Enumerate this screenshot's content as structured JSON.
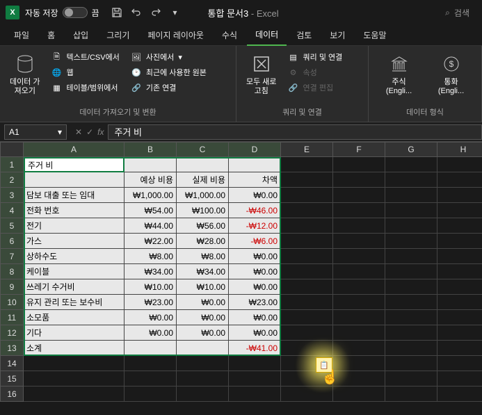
{
  "titlebar": {
    "autosave_label": "자동 저장",
    "autosave_state": "끔",
    "doc_name": "통합 문서3",
    "app_name": "Excel",
    "search_placeholder": "검색"
  },
  "tabs": {
    "items": [
      "파일",
      "홈",
      "삽입",
      "그리기",
      "페이지 레이아웃",
      "수식",
      "데이터",
      "검토",
      "보기",
      "도움말"
    ],
    "active": "데이터"
  },
  "ribbon": {
    "group1": {
      "label": "데이터 가져오기 및 변환",
      "big_btn": "데이터 가\n져오기",
      "items": [
        "텍스트/CSV에서",
        "웹",
        "테이블/범위에서",
        "사진에서",
        "최근에 사용한 원본",
        "기존 연결"
      ]
    },
    "group2": {
      "label": "쿼리 및 연결",
      "big_btn": "모두 새로\n고침",
      "items": [
        "쿼리 및 연결",
        "속성",
        "연결 편집"
      ]
    },
    "group3": {
      "label": "데이터 형식",
      "stock": "주식 (Engli...",
      "currency": "통화 (Engli..."
    }
  },
  "formula_bar": {
    "name_box": "A1",
    "value": "주거 비"
  },
  "grid": {
    "columns": [
      "A",
      "B",
      "C",
      "D",
      "E",
      "F",
      "G",
      "H"
    ],
    "rows_count": 16,
    "selection": "A1:D13",
    "headers": {
      "B": "예상 비용",
      "C": "실제 비용",
      "D": "차액"
    },
    "data": [
      {
        "label": "주거 비",
        "b": "",
        "c": "",
        "d": ""
      },
      {
        "label": "",
        "b": "예상 비용",
        "c": "실제 비용",
        "d": "차액"
      },
      {
        "label": "담보 대출 또는 임대",
        "b": "₩1,000.00",
        "c": "₩1,000.00",
        "d": "₩0.00"
      },
      {
        "label": "전화 번호",
        "b": "₩54.00",
        "c": "₩100.00",
        "d": "-₩46.00",
        "neg": true
      },
      {
        "label": "전기",
        "b": "₩44.00",
        "c": "₩56.00",
        "d": "-₩12.00",
        "neg": true
      },
      {
        "label": "가스",
        "b": "₩22.00",
        "c": "₩28.00",
        "d": "-₩6.00",
        "neg": true
      },
      {
        "label": "상하수도",
        "b": "₩8.00",
        "c": "₩8.00",
        "d": "₩0.00"
      },
      {
        "label": "케이블",
        "b": "₩34.00",
        "c": "₩34.00",
        "d": "₩0.00"
      },
      {
        "label": "쓰레기 수거비",
        "b": "₩10.00",
        "c": "₩10.00",
        "d": "₩0.00"
      },
      {
        "label": "유지 관리 또는 보수비",
        "b": "₩23.00",
        "c": "₩0.00",
        "d": "₩23.00"
      },
      {
        "label": "소모품",
        "b": "₩0.00",
        "c": "₩0.00",
        "d": "₩0.00"
      },
      {
        "label": "기다",
        "b": "₩0.00",
        "c": "₩0.00",
        "d": "₩0.00"
      },
      {
        "label": "소계",
        "b": "",
        "c": "",
        "d": "-₩41.00",
        "neg": true
      }
    ]
  }
}
